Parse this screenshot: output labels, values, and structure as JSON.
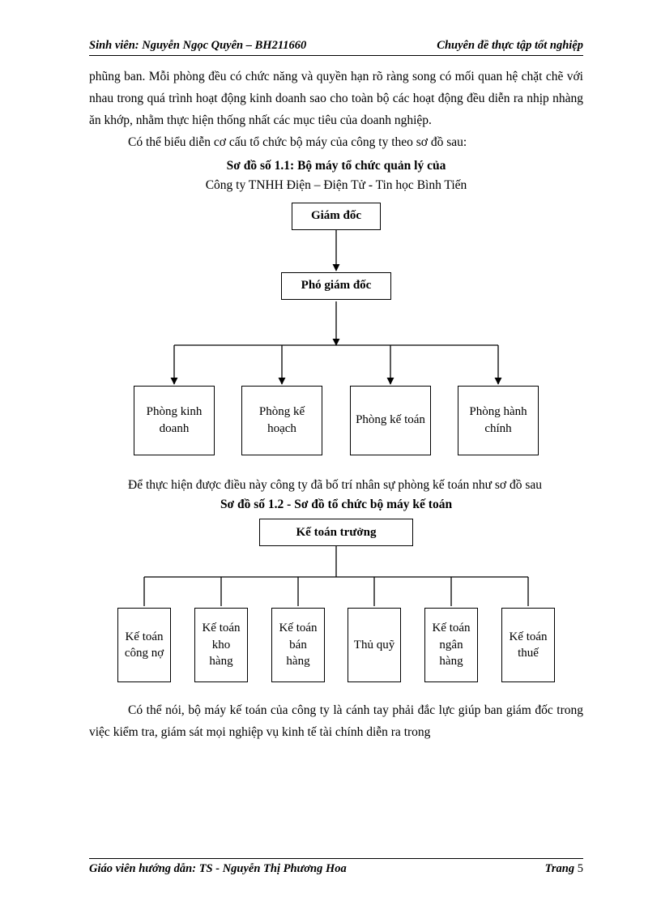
{
  "header": {
    "left": "Sinh viên: Nguyễn Ngọc Quyên – BH211660",
    "right": "Chuyên đề thực tập tốt nghiệp"
  },
  "body": {
    "p1": "phũng ban. Mỗi phòng đều có chức năng và quyền hạn rõ ràng song có mối quan hệ chặt chẽ với nhau trong quá trình hoạt động kinh doanh sao cho toàn bộ các hoạt động đều diễn ra nhịp nhàng ăn khớp, nhằm thực hiện thống nhất các mục tiêu của doanh nghiệp.",
    "p2": "Có thể biểu diễn cơ cấu tổ chức bộ máy của công ty theo sơ đồ sau:"
  },
  "diagram1": {
    "title": "Sơ đồ số 1.1: Bộ máy tổ chức quản  lý của",
    "subtitle": "Công ty TNHH  Điện – Điện Tử  - Tin học Bình Tiến",
    "top": "Giám đốc",
    "middle": "Phó giám đốc",
    "children": [
      "Phòng kinh doanh",
      "Phòng kế hoạch",
      "Phòng kế toán",
      "Phòng hành chính"
    ]
  },
  "note1": "Để thực hiện  được điều này công ty đã bố trí nhân sự phòng kế toán như sơ đồ sau",
  "diagram2": {
    "title": "Sơ đồ số 1.2 - Sơ đồ tổ chức bộ máy kế toán",
    "top": "Kế toán trưởng",
    "children": [
      "Kế toán công nợ",
      "Kế toán kho hàng",
      "Kế toán bán hàng",
      "Thủ quỹ",
      "Kế toán ngân hàng",
      "Kế toán thuế"
    ]
  },
  "closing": "Có thể nói, bộ máy kế toán của công ty là cánh tay phải đắc lực giúp ban giám đốc trong việc kiểm tra, giám sát mọi nghiệp vụ kinh tế tài chính diễn ra trong",
  "footer": {
    "left": "Giáo viên hướng dẫn: TS - Nguyễn Thị Phương Hoa",
    "page_label": "Trang ",
    "page_num": "5"
  },
  "chart_data": [
    {
      "type": "org-chart",
      "title": "Sơ đồ số 1.1: Bộ máy tổ chức quản lý của Công ty TNHH Điện – Điện Tử - Tin học Bình Tiến",
      "root": "Giám đốc",
      "levels": [
        [
          "Giám đốc"
        ],
        [
          "Phó giám đốc"
        ],
        [
          "Phòng kinh doanh",
          "Phòng kế hoạch",
          "Phòng kế toán",
          "Phòng hành chính"
        ]
      ]
    },
    {
      "type": "org-chart",
      "title": "Sơ đồ số 1.2 - Sơ đồ tổ chức bộ máy kế toán",
      "root": "Kế toán trưởng",
      "levels": [
        [
          "Kế toán trưởng"
        ],
        [
          "Kế toán công nợ",
          "Kế toán kho hàng",
          "Kế toán bán hàng",
          "Thủ quỹ",
          "Kế toán ngân hàng",
          "Kế toán thuế"
        ]
      ]
    }
  ]
}
